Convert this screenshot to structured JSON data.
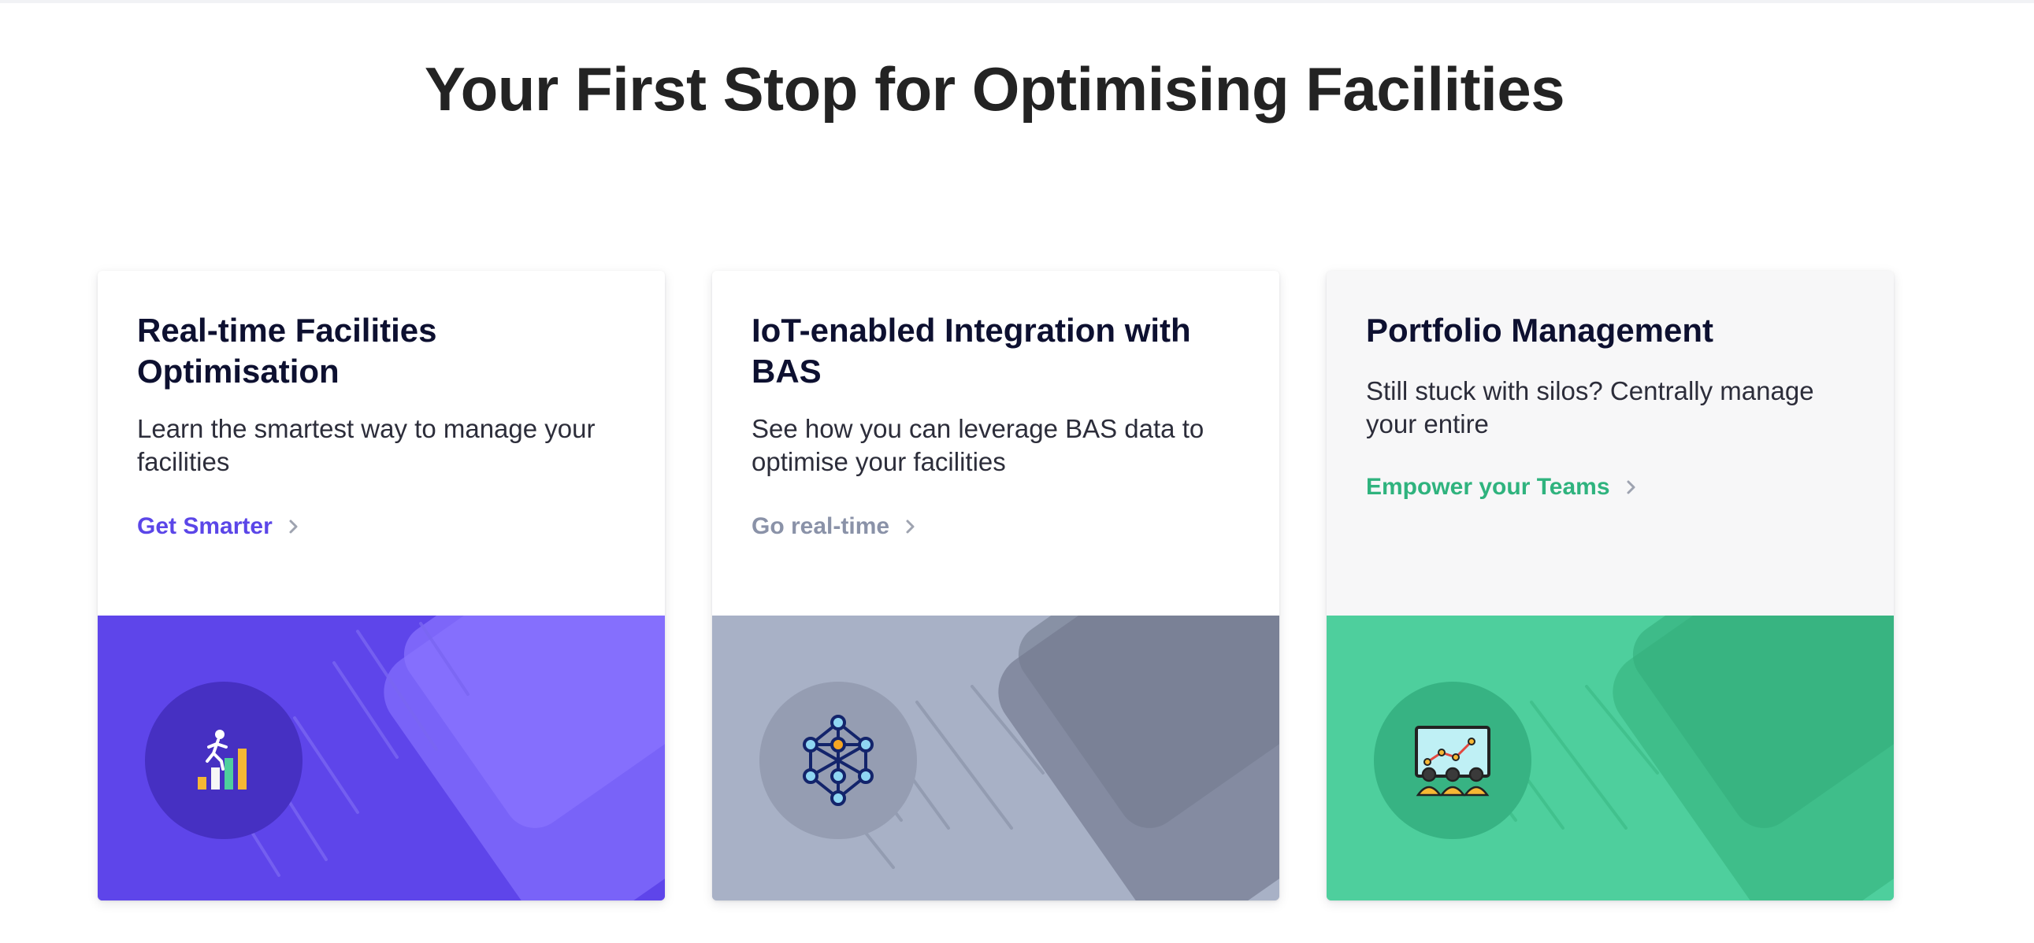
{
  "page": {
    "title": "Your First Stop for Optimising Facilities"
  },
  "cards": [
    {
      "title": "Real-time Facilities Optimisation",
      "description": "Learn the smartest way to manage your facilities",
      "link_label": "Get Smarter",
      "accent_color": "#5b46e8",
      "art_color": "#5e45ea",
      "icon": "climbing-growth-chart-icon"
    },
    {
      "title": "IoT-enabled Integration with BAS",
      "description": "See how you can leverage BAS data to optimise your facilities",
      "link_label": "Go real-time",
      "accent_color": "#8a92a8",
      "art_color": "#a8b1c6",
      "icon": "network-nodes-icon"
    },
    {
      "title": "Portfolio Management",
      "description": "Still stuck with silos? Centrally manage your entire",
      "link_label": "Empower your Teams",
      "accent_color": "#2fb37e",
      "art_color": "#4ecf9d",
      "icon": "team-presentation-icon"
    }
  ]
}
